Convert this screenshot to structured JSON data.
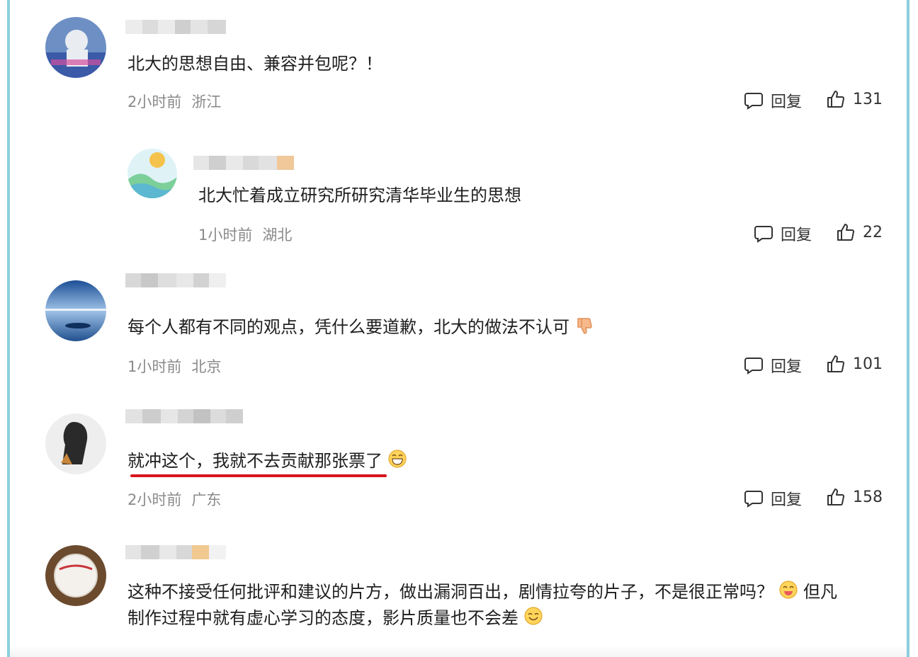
{
  "comments": [
    {
      "text": "北大的思想自由、兼容并包呢？！",
      "time": "2小时前",
      "location": "浙江",
      "reply_label": "回复",
      "likes": "131"
    },
    {
      "text": "北大忙着成立研究所研究清华毕业生的思想",
      "time": "1小时前",
      "location": "湖北",
      "reply_label": "回复",
      "likes": "22"
    },
    {
      "text": "每个人都有不同的观点，凭什么要道歉，北大的做法不认可",
      "time": "1小时前",
      "location": "北京",
      "reply_label": "回复",
      "likes": "101"
    },
    {
      "text": "就冲这个，我就不去贡献那张票了",
      "time": "2小时前",
      "location": "广东",
      "reply_label": "回复",
      "likes": "158"
    },
    {
      "text_line1": "这种不接受任何批评和建议的片方，做出漏洞百出，剧情拉夸的片子，不是很正常吗？",
      "text_line1_tail": "但凡",
      "text_line2": "制作过程中就有虚心学习的态度，影片质量也不会差"
    }
  ],
  "colors": {
    "frame": "#8ccfe0",
    "underline": "#d8141c",
    "meta": "#8a8a8a"
  },
  "icons": [
    "reply-bubble-icon",
    "thumbs-up-icon",
    "thumbs-down-emoji",
    "grin-emoji",
    "smile-emoji"
  ]
}
